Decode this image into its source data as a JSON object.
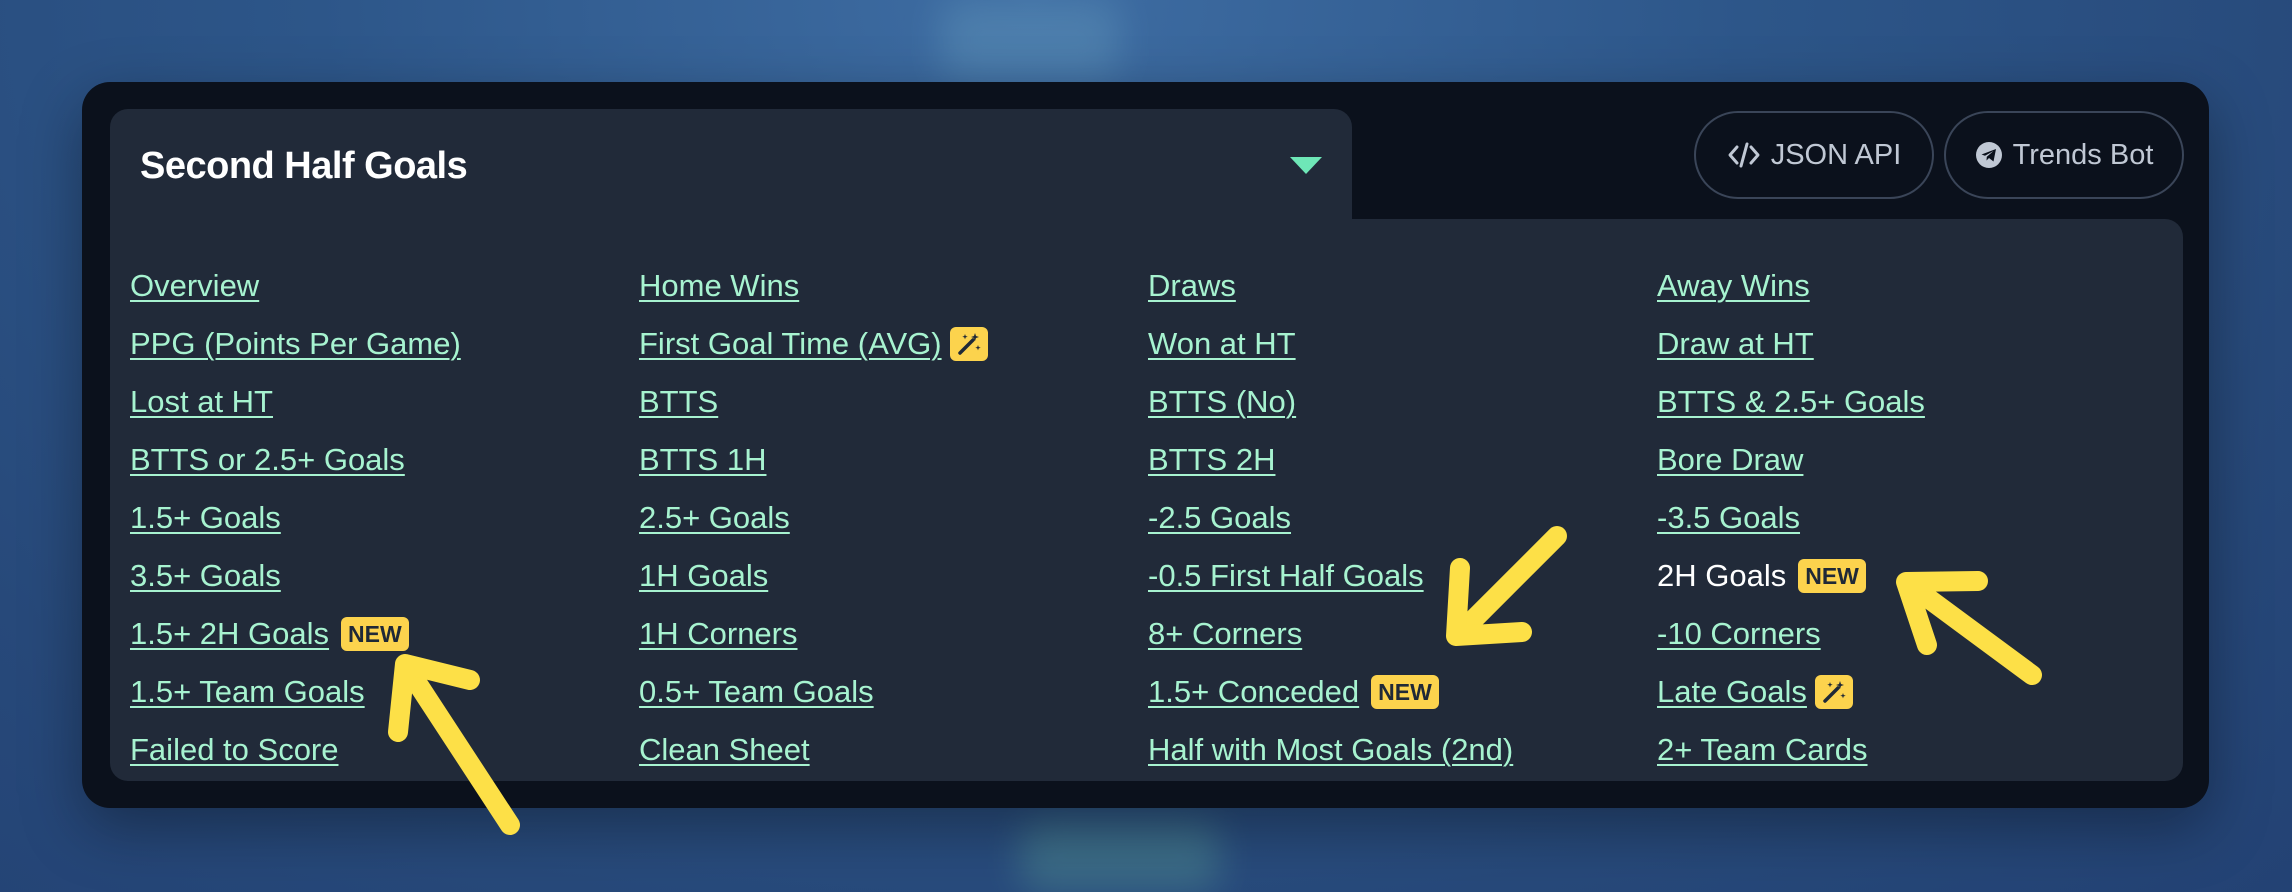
{
  "tab": {
    "title": "Second Half Goals"
  },
  "toolbar": {
    "json_api_label": "JSON API",
    "trends_bot_label": "Trends Bot"
  },
  "columns": [
    [
      {
        "label": "Overview",
        "link": true
      },
      {
        "label": "PPG (Points Per Game)",
        "link": true
      },
      {
        "label": "Lost at HT",
        "link": true
      },
      {
        "label": "BTTS or 2.5+ Goals",
        "link": true
      },
      {
        "label": "1.5+ Goals",
        "link": true
      },
      {
        "label": "3.5+ Goals",
        "link": true
      },
      {
        "label": "1.5+ 2H Goals",
        "link": true,
        "badge": "NEW"
      },
      {
        "label": "1.5+ Team Goals",
        "link": true
      },
      {
        "label": "Failed to Score",
        "link": true
      }
    ],
    [
      {
        "label": "Home Wins",
        "link": true
      },
      {
        "label": "First Goal Time (AVG)",
        "link": true,
        "icon": "magic-wand-icon"
      },
      {
        "label": "BTTS",
        "link": true
      },
      {
        "label": "BTTS 1H",
        "link": true
      },
      {
        "label": "2.5+ Goals",
        "link": true
      },
      {
        "label": "1H Goals",
        "link": true
      },
      {
        "label": "1H Corners",
        "link": true
      },
      {
        "label": "0.5+ Team Goals",
        "link": true
      },
      {
        "label": "Clean Sheet",
        "link": true
      }
    ],
    [
      {
        "label": "Draws",
        "link": true
      },
      {
        "label": "Won at HT",
        "link": true
      },
      {
        "label": "BTTS (No)",
        "link": true
      },
      {
        "label": "BTTS 2H",
        "link": true
      },
      {
        "label": "-2.5 Goals",
        "link": true
      },
      {
        "label": "-0.5 First Half Goals",
        "link": true
      },
      {
        "label": "8+ Corners",
        "link": true
      },
      {
        "label": "1.5+ Conceded",
        "link": true,
        "badge": "NEW"
      },
      {
        "label": "Half with Most Goals (2nd)",
        "link": true
      }
    ],
    [
      {
        "label": "Away Wins",
        "link": true
      },
      {
        "label": "Draw at HT",
        "link": true
      },
      {
        "label": "BTTS & 2.5+ Goals",
        "link": true
      },
      {
        "label": "Bore Draw",
        "link": true
      },
      {
        "label": "-3.5 Goals",
        "link": true
      },
      {
        "label": "2H Goals",
        "link": false,
        "badge": "NEW"
      },
      {
        "label": "-10 Corners",
        "link": true
      },
      {
        "label": "Late Goals",
        "link": true,
        "icon": "magic-wand-icon"
      },
      {
        "label": "2+ Team Cards",
        "link": true
      }
    ]
  ],
  "colors": {
    "link": "#a7f3d0",
    "badge": "#fcd34d",
    "annotation_arrow": "#fde047",
    "panel": "#212a39"
  }
}
